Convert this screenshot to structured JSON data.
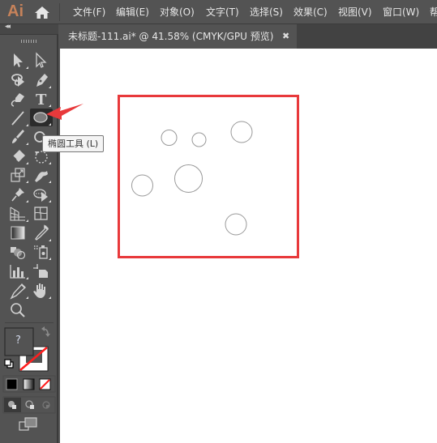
{
  "app": {
    "logo": "Ai",
    "home_icon": "home-icon"
  },
  "menu": [
    {
      "label": "文件(F)"
    },
    {
      "label": "编辑(E)"
    },
    {
      "label": "对象(O)"
    },
    {
      "label": "文字(T)"
    },
    {
      "label": "选择(S)"
    },
    {
      "label": "效果(C)"
    },
    {
      "label": "视图(V)"
    },
    {
      "label": "窗口(W)"
    },
    {
      "label": "帮"
    }
  ],
  "document_tab": {
    "title": "未标题-111.ai* @ 41.58% (CMYK/GPU 预览)",
    "close": "✖"
  },
  "toolbar": {
    "collapse": "◂◂",
    "tools": [
      {
        "name": "selection-tool",
        "icon": "arrow-solid"
      },
      {
        "name": "direct-selection-tool",
        "icon": "arrow-hollow"
      },
      {
        "name": "lasso-tool",
        "icon": "lasso"
      },
      {
        "name": "pen-tool",
        "icon": "pen-nib"
      },
      {
        "name": "curvature-tool",
        "icon": "curvature-pen"
      },
      {
        "name": "type-tool",
        "icon": "T"
      },
      {
        "name": "line-segment-tool",
        "icon": "line"
      },
      {
        "name": "ellipse-tool",
        "icon": "ellipse",
        "active": true
      },
      {
        "name": "paintbrush-tool",
        "icon": "brush"
      },
      {
        "name": "shaper-tool",
        "icon": "shaper"
      },
      {
        "name": "eraser-tool",
        "icon": "eraser"
      },
      {
        "name": "rotate-tool",
        "icon": "rotate"
      },
      {
        "name": "scale-tool",
        "icon": "scale"
      },
      {
        "name": "warp-tool",
        "icon": "warp"
      },
      {
        "name": "puppet-warp-tool",
        "icon": "pin"
      },
      {
        "name": "shape-builder-tool",
        "icon": "shape-builder"
      },
      {
        "name": "perspective-grid-tool",
        "icon": "perspective"
      },
      {
        "name": "mesh-tool",
        "icon": "mesh"
      },
      {
        "name": "gradient-tool",
        "icon": "gradient"
      },
      {
        "name": "eyedropper-tool",
        "icon": "eyedropper"
      },
      {
        "name": "blend-tool",
        "icon": "blend"
      },
      {
        "name": "symbol-sprayer-tool",
        "icon": "symbol-sprayer"
      },
      {
        "name": "column-graph-tool",
        "icon": "bar-graph"
      },
      {
        "name": "artboard-tool",
        "icon": "artboard"
      },
      {
        "name": "slice-tool",
        "icon": "slice"
      },
      {
        "name": "hand-tool",
        "icon": "hand"
      },
      {
        "name": "zoom-tool",
        "icon": "magnifier"
      }
    ],
    "fill_stroke": {
      "fill_label": "?",
      "stroke": "none"
    },
    "color_modes": [
      "color",
      "gradient",
      "none"
    ],
    "draw_modes": [
      "draw-normal",
      "draw-behind",
      "draw-inside"
    ],
    "screen_mode": "change-screen-mode"
  },
  "tooltip": {
    "text": "椭圆工具 (L)"
  },
  "colors": {
    "artboard_border": "#e8393b",
    "arrow": "#e8393b",
    "ui_bg": "#535353",
    "logo": "#c6825a"
  },
  "canvas": {
    "circles": [
      {
        "id": "circle-1"
      },
      {
        "id": "circle-2"
      },
      {
        "id": "circle-3"
      },
      {
        "id": "circle-4"
      },
      {
        "id": "circle-5"
      },
      {
        "id": "circle-6"
      }
    ]
  }
}
